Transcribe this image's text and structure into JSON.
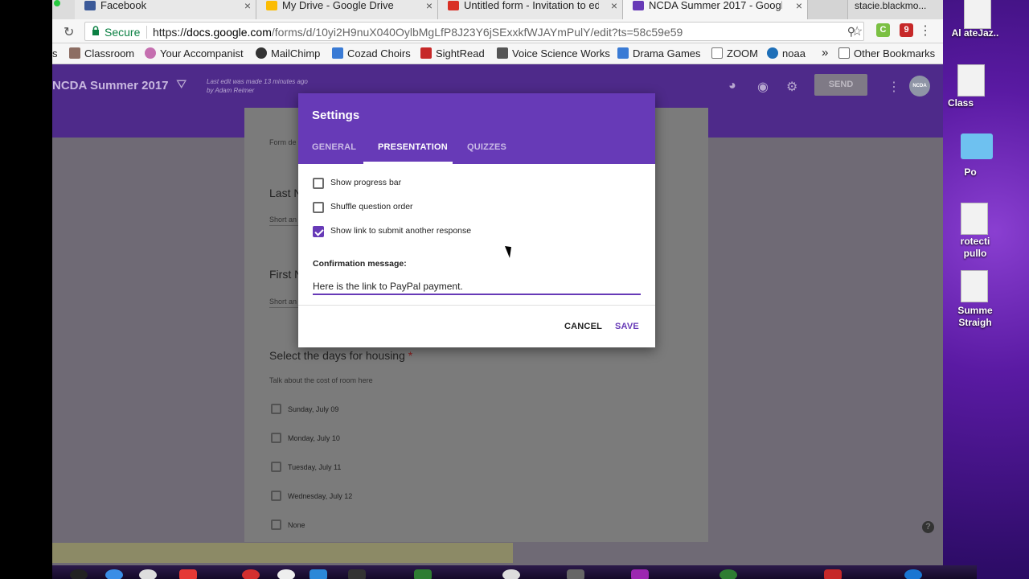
{
  "browser": {
    "tabs": [
      {
        "title": "Facebook",
        "color": "#3b5998"
      },
      {
        "title": "My Drive - Google Drive",
        "color": "#fbbc04"
      },
      {
        "title": "Untitled form - Invitation to ed",
        "color": "#d93025"
      },
      {
        "title": "NCDA Summer 2017 - Google",
        "color": "#673ab7"
      }
    ],
    "tab_close": "×",
    "profile_name": "stacie.blackmo...",
    "address": {
      "secure_label": "Secure",
      "url_scheme": "https://",
      "url_host": "docs.google.com",
      "url_path": "/forms/d/10yi2H9nuX040OylbMgLfP8J23Y6jSExxkfWJAYmPulY/edit?ts=58c59e59"
    },
    "extensions": [
      {
        "label": "C",
        "color": "#7bc043"
      },
      {
        "label": "9",
        "color": "#c62828"
      }
    ],
    "bookmarks": [
      {
        "label": "s",
        "icon": "apps-icon",
        "color": "#999"
      },
      {
        "label": "Classroom",
        "icon": "classroom-icon",
        "color": "#8d6e63"
      },
      {
        "label": "Your Accompanist",
        "icon": "accompanist-icon",
        "color": "#c56fb0"
      },
      {
        "label": "MailChimp",
        "icon": "mailchimp-icon",
        "color": "#333"
      },
      {
        "label": "Cozad Choirs",
        "icon": "weebly-icon",
        "color": "#3a7bd5"
      },
      {
        "label": "SightRead",
        "icon": "sightread-icon",
        "color": "#c62828"
      },
      {
        "label": "Voice Science Works",
        "icon": "voice-icon",
        "color": "#555"
      },
      {
        "label": "Drama Games",
        "icon": "drama-icon",
        "color": "#3a7bd5"
      },
      {
        "label": "ZOOM",
        "icon": "page-icon",
        "color": "#fff"
      },
      {
        "label": "noaa",
        "icon": "noaa-icon",
        "color": "#1e6fb8"
      }
    ],
    "more_bookmarks": "»",
    "other_bookmarks": "Other Bookmarks"
  },
  "form_page": {
    "title": "NCDA Summer 2017",
    "last_edit": "Last edit was made 13 minutes ago by Adam Reimer",
    "send_label": "SEND",
    "avatar_text": "NCDA",
    "form_desc": "Form de",
    "questions": [
      {
        "title": "Last N",
        "hint": "Short an"
      },
      {
        "title": "First N",
        "hint": "Short an"
      }
    ],
    "housing": {
      "title": "Select the days for housing",
      "required": "*",
      "description": "Talk about the cost of room here",
      "options": [
        "Sunday, July 09",
        "Monday, July 10",
        "Tuesday, July 11",
        "Wednesday, July 12",
        "None"
      ]
    },
    "help": "?"
  },
  "settings_dialog": {
    "title": "Settings",
    "tabs": [
      "GENERAL",
      "PRESENTATION",
      "QUIZZES"
    ],
    "active_tab": "PRESENTATION",
    "options": [
      {
        "label": "Show progress bar",
        "checked": false
      },
      {
        "label": "Shuffle question order",
        "checked": false
      },
      {
        "label": "Show link to submit another response",
        "checked": true
      }
    ],
    "confirmation_label": "Confirmation message:",
    "confirmation_value": "Here is the link to PayPal payment.",
    "cancel_label": "CANCEL",
    "save_label": "SAVE",
    "accent": "#673ab7"
  },
  "desktop": {
    "items": [
      "Al\nateJaz..",
      "Class",
      "Po",
      "rotecti\npullo",
      "Summe\nStraigh"
    ]
  }
}
